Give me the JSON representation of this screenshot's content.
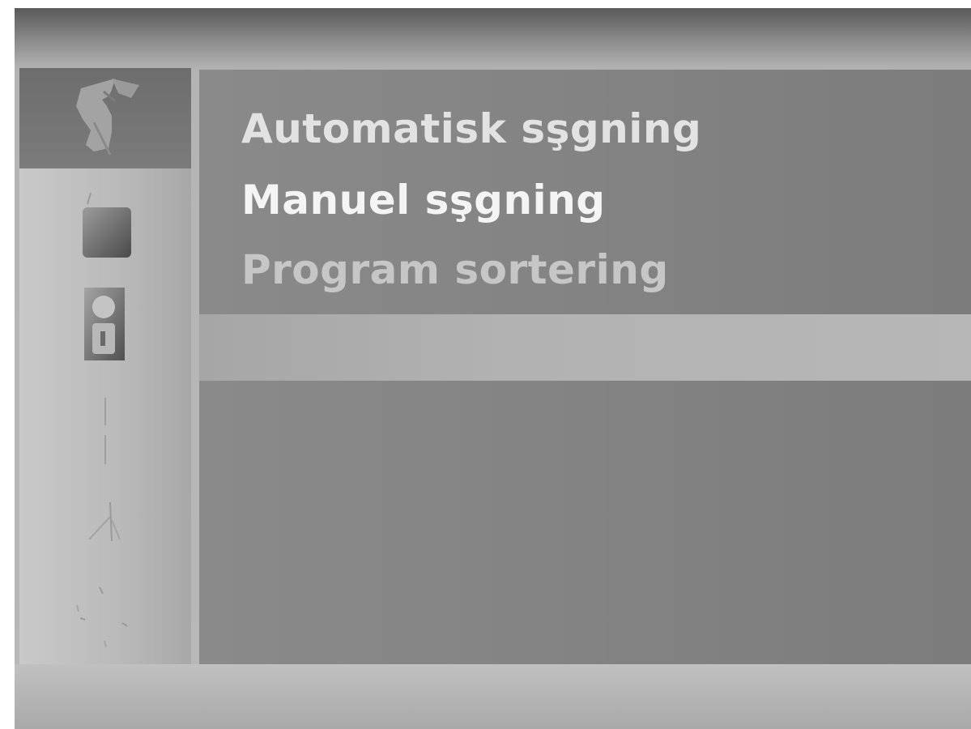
{
  "menu": {
    "items": [
      {
        "label": "Automatisk sşgning"
      },
      {
        "label": "Manuel sşgning"
      },
      {
        "label": "Program sortering"
      }
    ]
  },
  "sidebar": {
    "icons": [
      {
        "name": "satellite-dish-icon",
        "selected": true
      },
      {
        "name": "tv-icon",
        "selected": false
      },
      {
        "name": "lock-icon",
        "selected": false
      },
      {
        "name": "channel-icon",
        "selected": false
      },
      {
        "name": "antenna-icon",
        "selected": false
      },
      {
        "name": "settings-icon",
        "selected": false
      }
    ]
  },
  "colors": {
    "panel": "#838383",
    "selected_tab": "#707070",
    "highlight_bar": "#b2b2b2",
    "text_active": "#f4f4f4",
    "text_dim": "#c6c6c6"
  }
}
